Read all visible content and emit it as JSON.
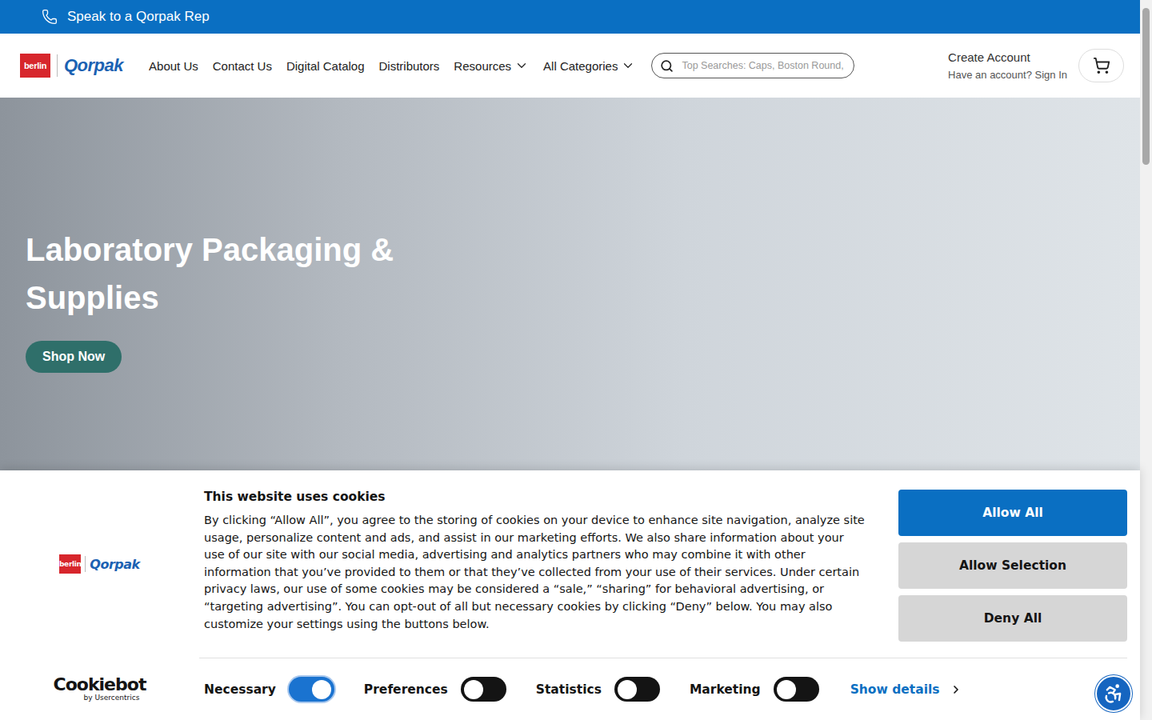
{
  "top_bar": {
    "label": "Speak to a Qorpak Rep"
  },
  "logo": {
    "badge": "berlin",
    "name": "Qorpak"
  },
  "nav": [
    {
      "label": "About Us",
      "kind": "link"
    },
    {
      "label": "Contact Us",
      "kind": "link"
    },
    {
      "label": "Digital Catalog",
      "kind": "link"
    },
    {
      "label": "Distributors",
      "kind": "link"
    },
    {
      "label": "Resources",
      "kind": "dropdown"
    },
    {
      "label": "All Categories",
      "kind": "dropdown"
    }
  ],
  "search": {
    "placeholder": "Top Searches: Caps, Boston Round,"
  },
  "account": {
    "create": "Create Account",
    "sign_in": "Have an account? Sign In"
  },
  "hero": {
    "title": "Laboratory Packaging & Supplies",
    "button": "Shop Now"
  },
  "cookie_banner": {
    "title": "This website uses cookies",
    "body": "By clicking “Allow All”, you agree to the storing of cookies on your device to enhance site navigation, analyze site usage, personalize content and ads, and assist in our marketing efforts. We also share information about your use of our site with our social media, advertising and analytics partners who may combine it with other information that you’ve provided to them or that they’ve collected from your use of their services. Under certain privacy laws, our use of some cookies may be considered a “sale,” “sharing” for behavioral advertising, or “targeting advertising”. You can opt-out of all but necessary cookies by clicking “Deny” below. You may also customize your settings using the buttons below.",
    "buttons": [
      {
        "label": "Allow All",
        "kind": "primary"
      },
      {
        "label": "Allow Selection",
        "kind": "secondary"
      },
      {
        "label": "Deny All",
        "kind": "secondary"
      }
    ],
    "consent": [
      {
        "label": "Necessary",
        "on": true
      },
      {
        "label": "Preferences",
        "on": false
      },
      {
        "label": "Statistics",
        "on": false
      },
      {
        "label": "Marketing",
        "on": false
      }
    ],
    "details": "Show details",
    "provider": {
      "name": "Cookiebot",
      "by": "by Usercentrics"
    }
  }
}
